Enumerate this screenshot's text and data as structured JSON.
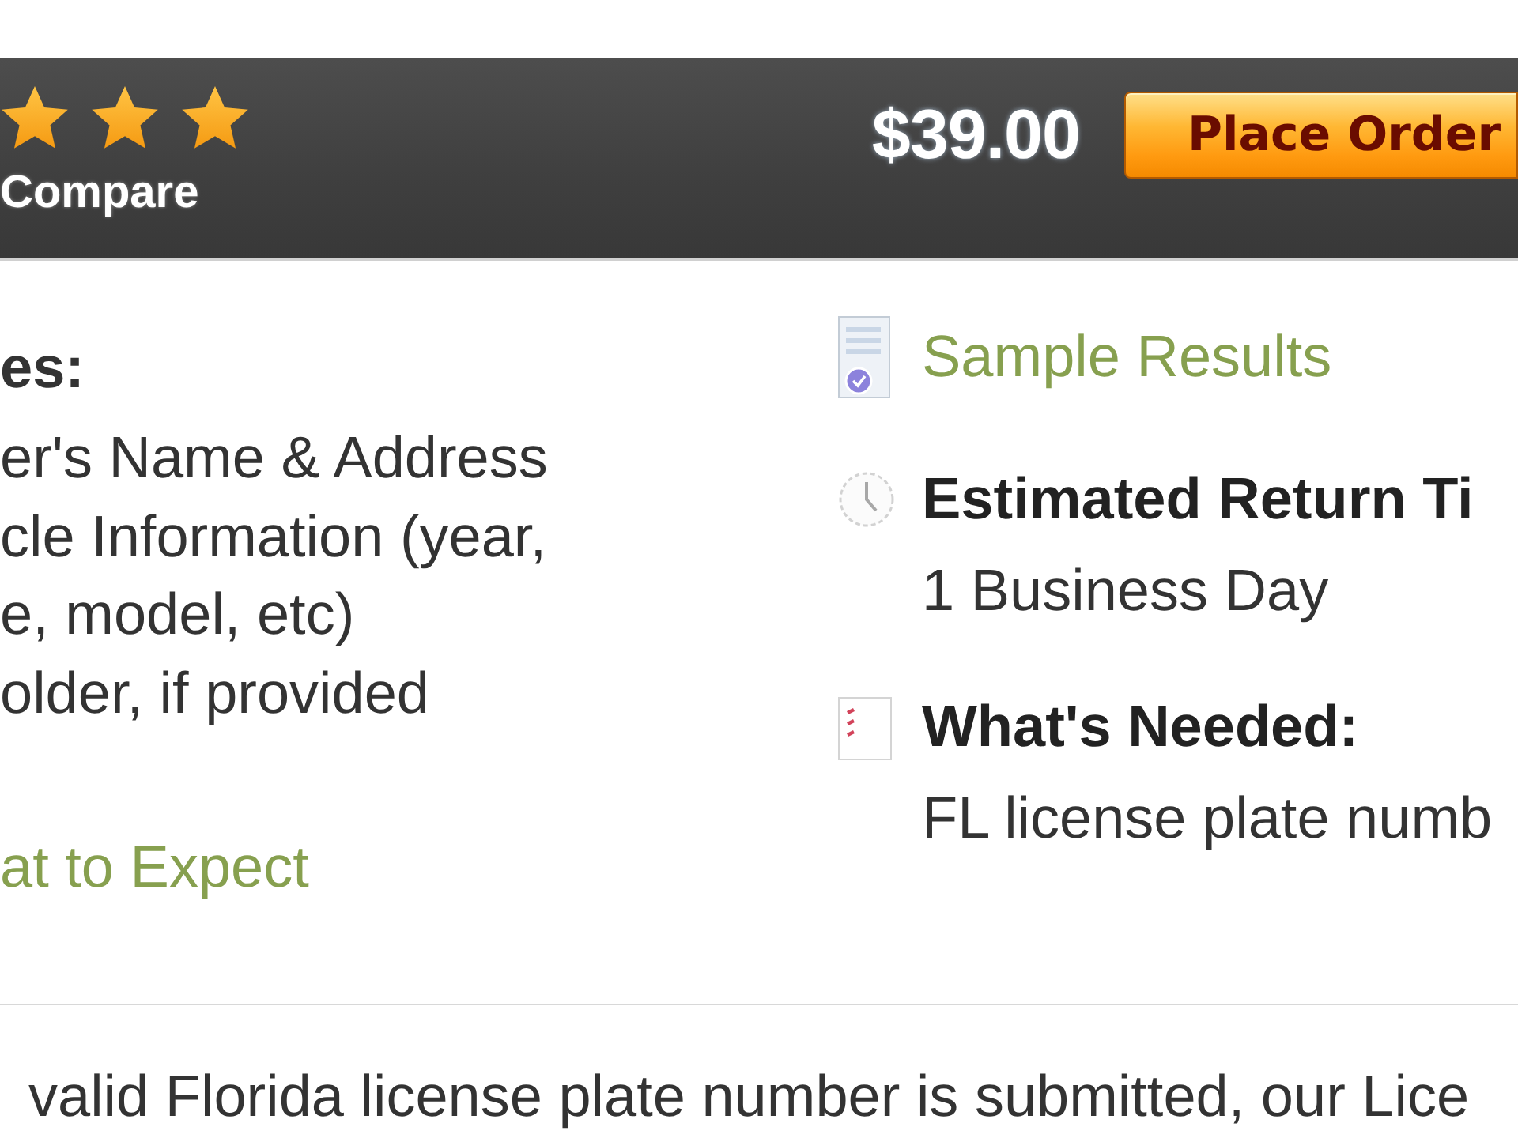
{
  "header_bar": {
    "rating": {
      "stars": 3
    },
    "compare_link": "Compare",
    "price": "$39.00",
    "order_button": "Place Order"
  },
  "includes": {
    "heading": "es:",
    "items": [
      {
        "lines": [
          "er's Name & Address"
        ]
      },
      {
        "lines": [
          "cle Information (year,",
          "e, model, etc)"
        ]
      },
      {
        "lines": [
          "older, if provided"
        ]
      }
    ],
    "link": "at to Expect"
  },
  "details": [
    {
      "kind": "link",
      "title": "Sample Results"
    },
    {
      "kind": "info",
      "title": "Estimated Return Ti",
      "value": "1 Business Day"
    },
    {
      "kind": "info",
      "title": "What's Needed:",
      "value": "FL license plate numb"
    }
  ],
  "footer_text": "valid Florida license plate number is submitted, our Lice"
}
